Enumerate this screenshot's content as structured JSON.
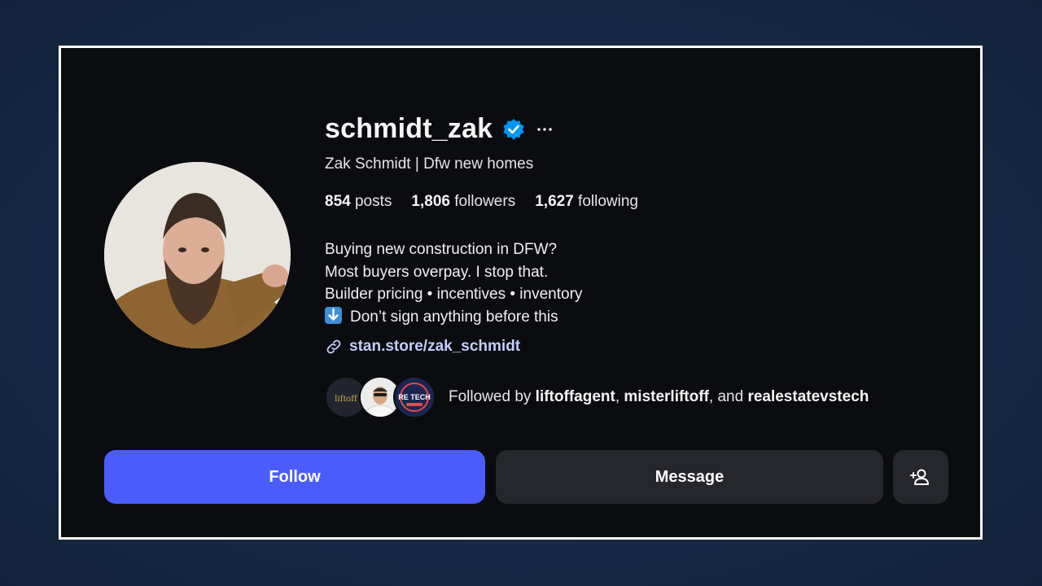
{
  "profile": {
    "username": "schmidt_zak",
    "full_name": "Zak Schmidt | Dfw new homes",
    "verified": true
  },
  "stats": {
    "posts_count": "854",
    "posts_label": "posts",
    "followers_count": "1,806",
    "followers_label": "followers",
    "following_count": "1,627",
    "following_label": "following"
  },
  "bio": {
    "line1": "Buying new construction in DFW?",
    "line2": "Most buyers overpay. I stop that.",
    "line3": "Builder pricing • incentives • inventory",
    "line4": "Don’t sign anything before this"
  },
  "link": {
    "text": "stan.store/zak_schmidt"
  },
  "followed_by": {
    "prefix": "Followed by ",
    "user1": "liftoffagent",
    "sep1": ", ",
    "user2": "misterliftoff",
    "sep2": ", and ",
    "user3": "realestatevstech",
    "avatars": [
      {
        "label": "liftoff"
      },
      {
        "label": ""
      },
      {
        "label": "RE TECH"
      }
    ]
  },
  "actions": {
    "follow_label": "Follow",
    "message_label": "Message"
  },
  "colors": {
    "follow_button": "#4a5dfa",
    "secondary_button": "#25272c",
    "verified_badge": "#0095f6",
    "link": "#c4cdff",
    "card_background": "#0b0c10",
    "page_background": "#172a46"
  }
}
